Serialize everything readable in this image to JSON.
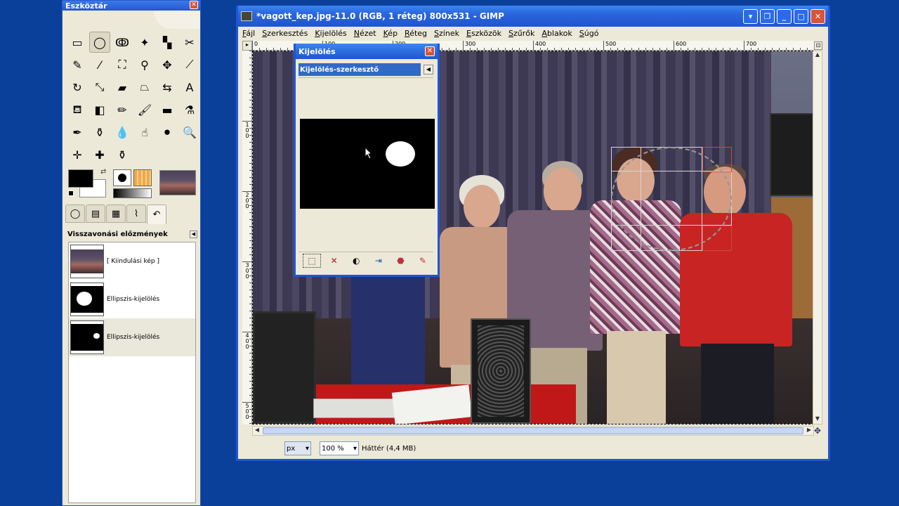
{
  "toolbox": {
    "title": "Eszköztár",
    "tools": [
      {
        "name": "rect-select-icon",
        "glyph": "▭"
      },
      {
        "name": "ellipse-select-icon",
        "glyph": "◯"
      },
      {
        "name": "free-select-icon",
        "glyph": "ↂ"
      },
      {
        "name": "fuzzy-select-icon",
        "glyph": "✦"
      },
      {
        "name": "color-select-icon",
        "glyph": "▚"
      },
      {
        "name": "scissors-icon",
        "glyph": "✂"
      },
      {
        "name": "paths-icon",
        "glyph": "✎"
      },
      {
        "name": "color-picker-icon",
        "glyph": "⁄"
      },
      {
        "name": "zoom-move-icon",
        "glyph": "⛶"
      },
      {
        "name": "measure-icon",
        "glyph": "⚲"
      },
      {
        "name": "move-icon",
        "glyph": "✥"
      },
      {
        "name": "crop-icon",
        "glyph": "⟋"
      },
      {
        "name": "rotate-icon",
        "glyph": "↻"
      },
      {
        "name": "scale-icon",
        "glyph": "⤡"
      },
      {
        "name": "shear-icon",
        "glyph": "▰"
      },
      {
        "name": "perspective-icon",
        "glyph": "⏢"
      },
      {
        "name": "flip-icon",
        "glyph": "⇆"
      },
      {
        "name": "text-icon",
        "glyph": "A"
      },
      {
        "name": "bucket-fill-icon",
        "glyph": "⛾"
      },
      {
        "name": "blend-icon",
        "glyph": "◧"
      },
      {
        "name": "pencil-icon",
        "glyph": "✏"
      },
      {
        "name": "paintbrush-icon",
        "glyph": "🖌"
      },
      {
        "name": "eraser-icon",
        "glyph": "▬"
      },
      {
        "name": "airbrush-icon",
        "glyph": "⚗"
      },
      {
        "name": "ink-icon",
        "glyph": "✒"
      },
      {
        "name": "clone-icon",
        "glyph": "⚱"
      },
      {
        "name": "blur-icon",
        "glyph": "💧"
      },
      {
        "name": "smudge-icon",
        "glyph": "☝"
      },
      {
        "name": "dodge-burn-icon",
        "glyph": "⚫"
      },
      {
        "name": "magnify-icon",
        "glyph": "🔍"
      },
      {
        "name": "align-icon",
        "glyph": "✛"
      },
      {
        "name": "heal-icon",
        "glyph": "✚"
      },
      {
        "name": "perspective-clone-icon",
        "glyph": "⚱"
      }
    ],
    "tabs": [
      {
        "name": "tab-tool-options",
        "glyph": "◯"
      },
      {
        "name": "tab-layers",
        "glyph": "▤"
      },
      {
        "name": "tab-channels",
        "glyph": "▦"
      },
      {
        "name": "tab-paths",
        "glyph": "⌇"
      },
      {
        "name": "tab-undo-history",
        "glyph": "↶"
      }
    ],
    "undo_panel": {
      "title": "Visszavonási előzmények",
      "items": [
        {
          "label": "[ Kiindulási kép ]"
        },
        {
          "label": "Ellipszis-kijelölés"
        },
        {
          "label": "Ellipszis-kijelölés"
        }
      ]
    }
  },
  "image_window": {
    "title": "*vagott_kep.jpg-11.0 (RGB, 1 réteg) 800x531 - GIMP",
    "menu": [
      "Fájl",
      "Szerkesztés",
      "Kijelölés",
      "Nézet",
      "Kép",
      "Réteg",
      "Színek",
      "Eszközök",
      "Szűrők",
      "Ablakok",
      "Súgó"
    ],
    "ruler_h": [
      "0",
      "100",
      "200",
      "300",
      "400",
      "500",
      "600",
      "700"
    ],
    "ruler_v": [
      "1\n0\n0",
      "2\n0\n0",
      "3\n0\n0",
      "4\n0\n0",
      "5\n0\n0"
    ],
    "status": {
      "unit": "px",
      "zoom": "100 %",
      "info": "Háttér (4,4 MB)"
    }
  },
  "selection_editor": {
    "title": "Kijelölés",
    "tab_label": "Kijelölés-szerkesztő",
    "tools": [
      {
        "name": "select-all-button",
        "glyph": "⬚"
      },
      {
        "name": "select-none-button",
        "glyph": "✕"
      },
      {
        "name": "invert-selection-button",
        "glyph": "◐"
      },
      {
        "name": "save-to-channel-button",
        "glyph": "⇥"
      },
      {
        "name": "to-path-button",
        "glyph": "⬣"
      },
      {
        "name": "stroke-selection-button",
        "glyph": "✎"
      }
    ]
  },
  "colors": {
    "accent_blue": "#1f55d6",
    "close_red": "#d8543a",
    "selection_tab": "#3169c6",
    "desktop": "#0a3f9a"
  }
}
